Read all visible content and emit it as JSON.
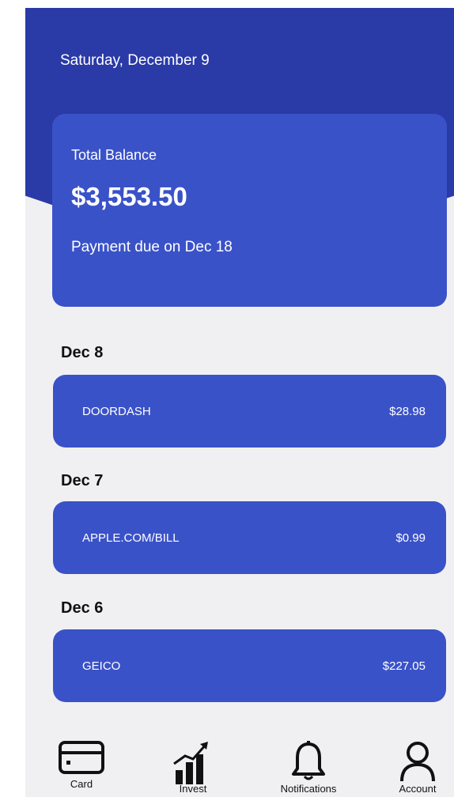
{
  "header": {
    "date": "Saturday, December 9"
  },
  "balance": {
    "label": "Total Balance",
    "amount": "$3,553.50",
    "due": "Payment due on Dec 18"
  },
  "transactions": [
    {
      "date": "Dec 8",
      "merchant": "DOORDASH",
      "amount": "$28.98"
    },
    {
      "date": "Dec 7",
      "merchant": "APPLE.COM/BILL",
      "amount": "$0.99"
    },
    {
      "date": "Dec 6",
      "merchant": "GEICO",
      "amount": "$227.05"
    }
  ],
  "nav": [
    {
      "label": "Card",
      "icon": "credit-card-icon"
    },
    {
      "label": "Invest",
      "icon": "bar-chart-trend-icon"
    },
    {
      "label": "Notifications",
      "icon": "bell-icon"
    },
    {
      "label": "Account",
      "icon": "person-icon"
    }
  ],
  "colors": {
    "header": "#2a3aa6",
    "card": "#3a52c8",
    "background": "#f0f0f2"
  }
}
